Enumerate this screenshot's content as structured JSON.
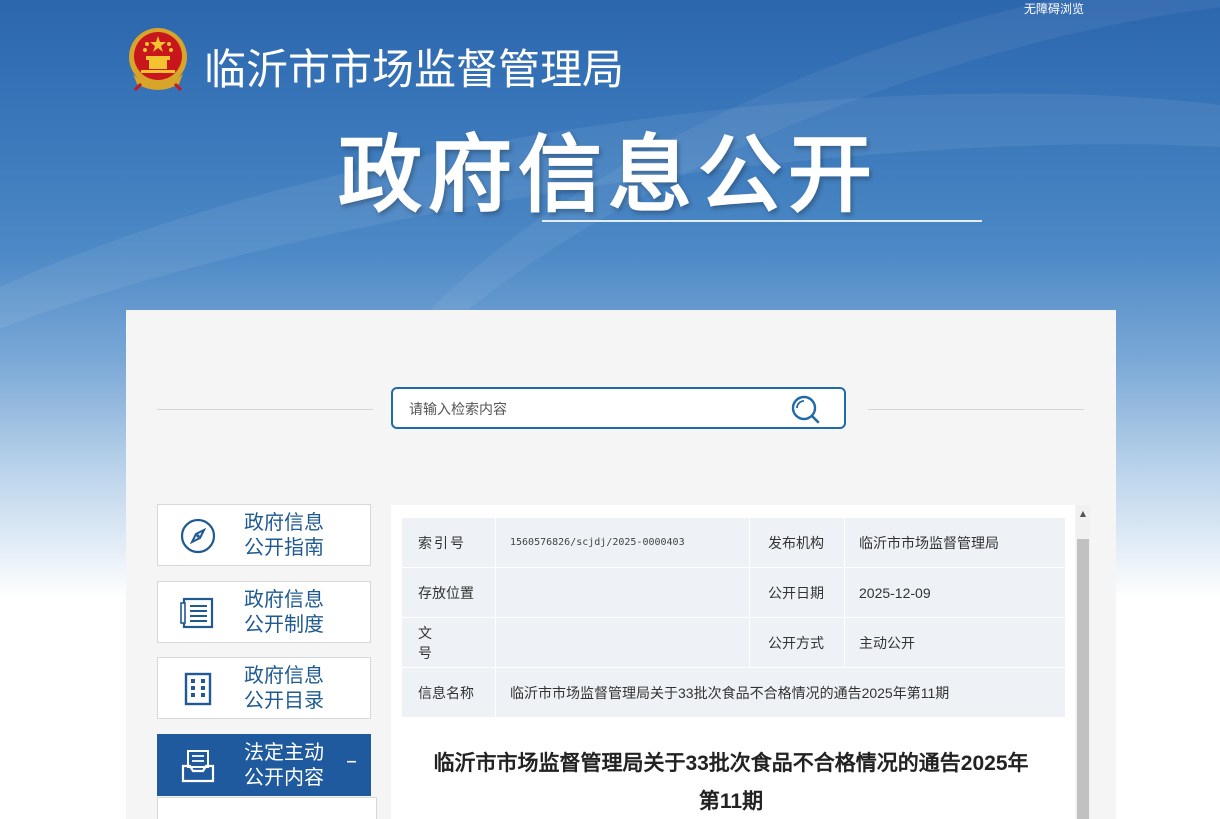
{
  "header": {
    "accessibility_link": "无障碍浏览",
    "site_title": "临沂市市场监督管理局",
    "section_title": "政府信息公开"
  },
  "search": {
    "placeholder": "请输入检索内容"
  },
  "sidebar": {
    "items": [
      {
        "label_line1": "政府信息",
        "label_line2": "公开指南",
        "icon": "compass-icon"
      },
      {
        "label_line1": "政府信息",
        "label_line2": "公开制度",
        "icon": "list-document-icon"
      },
      {
        "label_line1": "政府信息",
        "label_line2": "公开目录",
        "icon": "building-grid-icon"
      },
      {
        "label_line1": "法定主动",
        "label_line2": "公开内容",
        "icon": "inbox-document-icon",
        "active": true,
        "toggle": "–"
      }
    ]
  },
  "info": {
    "index_label": "索引号",
    "index_value": "1560576826/scjdj/2025-0000403",
    "publisher_label": "发布机构",
    "publisher_value": "临沂市市场监督管理局",
    "location_label": "存放位置",
    "location_value": "",
    "date_label": "公开日期",
    "date_value": "2025-12-09",
    "docno_label": "文号",
    "docno_value": "",
    "method_label": "公开方式",
    "method_value": "主动公开",
    "name_label": "信息名称",
    "name_value": "临沂市市场监督管理局关于33批次食品不合格情况的通告2025年第11期"
  },
  "article": {
    "title_line1": "临沂市市场监督管理局关于33批次食品不合格情况的通告2025年",
    "title_line2": "第11期"
  },
  "colors": {
    "brand_blue": "#1f5a9e",
    "search_border": "#1f6ba8",
    "table_bg": "#eef2f6"
  }
}
